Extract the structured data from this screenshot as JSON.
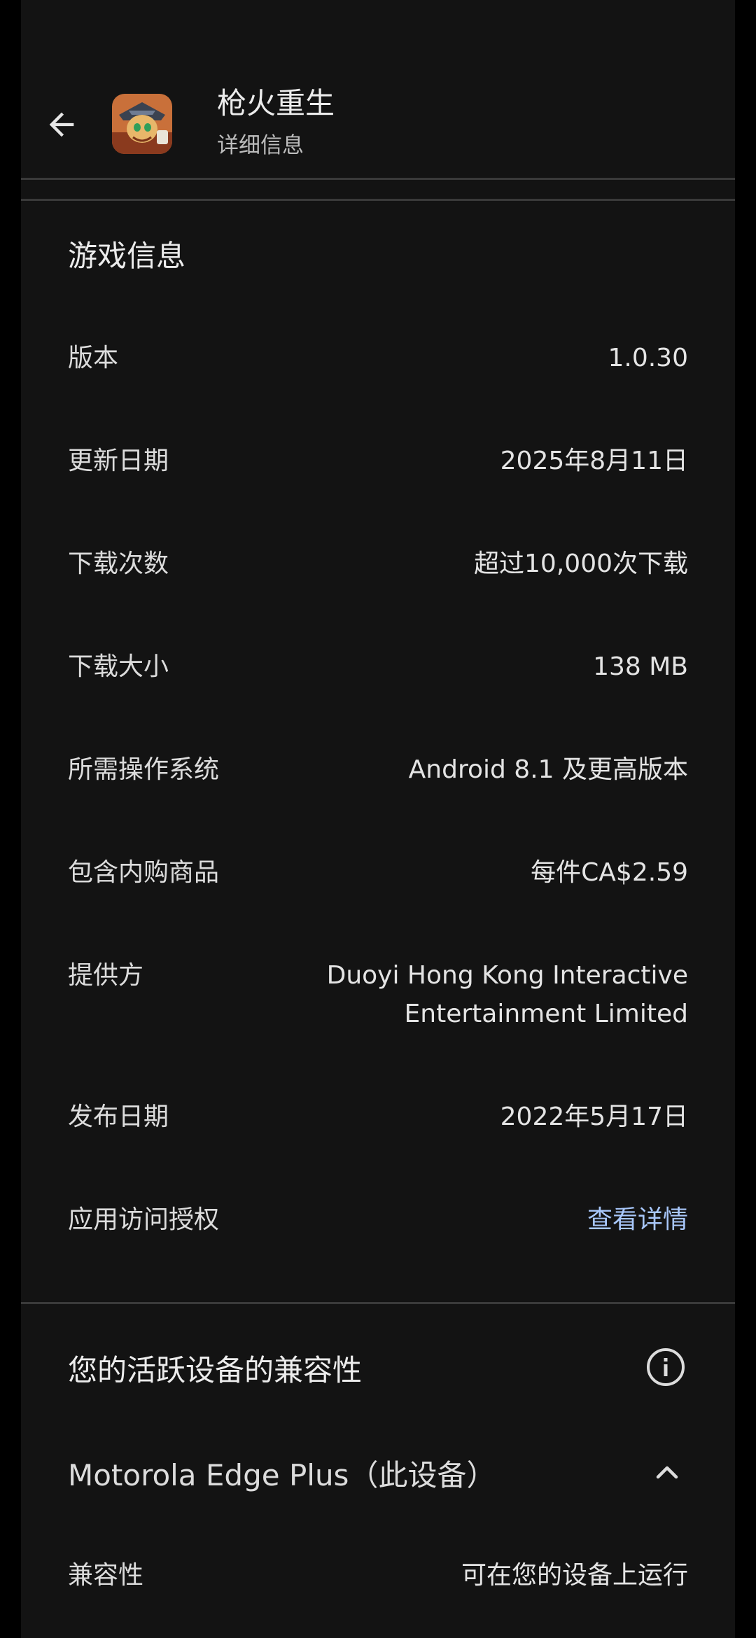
{
  "header": {
    "app_name": "枪火重生",
    "subtitle": "详细信息"
  },
  "game_info": {
    "title": "游戏信息",
    "rows": [
      {
        "label": "版本",
        "value": "1.0.30"
      },
      {
        "label": "更新日期",
        "value": "2025年8月11日"
      },
      {
        "label": "下载次数",
        "value": "超过10,000次下载"
      },
      {
        "label": "下载大小",
        "value": "138 MB"
      },
      {
        "label": "所需操作系统",
        "value": "Android 8.1 及更高版本"
      },
      {
        "label": "包含内购商品",
        "value": "每件CA$2.59"
      },
      {
        "label": "提供方",
        "value_line1": "Duoyi Hong Kong Interactive",
        "value_line2": "Entertainment Limited"
      },
      {
        "label": "发布日期",
        "value": "2022年5月17日"
      },
      {
        "label": "应用访问授权",
        "value": "查看详情"
      }
    ]
  },
  "compatibility": {
    "title": "您的活跃设备的兼容性",
    "device": "Motorola Edge Plus（此设备）",
    "label": "兼容性",
    "value": "可在您的设备上运行"
  },
  "colors": {
    "background": "#131313",
    "link": "#a8c7fa",
    "divider": "#3a3a3a"
  },
  "icons": [
    "back-arrow-icon",
    "app-icon",
    "info-icon",
    "chevron-up-icon"
  ]
}
